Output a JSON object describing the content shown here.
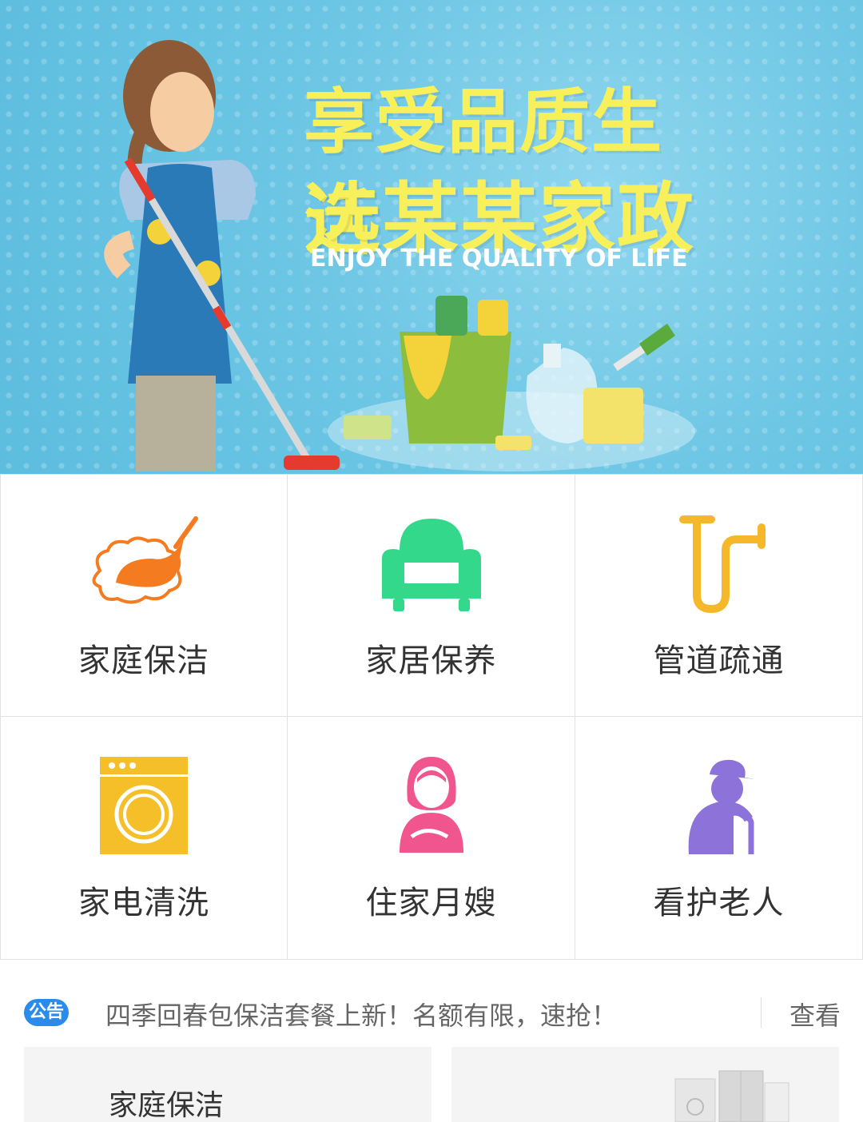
{
  "banner": {
    "title_line1": "享受品质生活",
    "title_line2": "选某某家政",
    "subtitle": "ENJOY THE QUALITY OF LIFE"
  },
  "services": [
    {
      "label": "家庭保洁",
      "icon": "broom-icon",
      "color": "#f47b20"
    },
    {
      "label": "家居保养",
      "icon": "sofa-icon",
      "color": "#33d88a"
    },
    {
      "label": "管道疏通",
      "icon": "pipe-icon",
      "color": "#f5b82a"
    },
    {
      "label": "家电清洗",
      "icon": "washing-machine-icon",
      "color": "#f5bf2a"
    },
    {
      "label": "住家月嫂",
      "icon": "nanny-icon",
      "color": "#f0558e"
    },
    {
      "label": "看护老人",
      "icon": "elderly-icon",
      "color": "#8c72d9"
    }
  ],
  "notice": {
    "badge": "公告",
    "text": "四季回春包保洁套餐上新！名额有限，速抢！",
    "more": "查看"
  },
  "cards": {
    "left_title": "家庭保洁"
  }
}
